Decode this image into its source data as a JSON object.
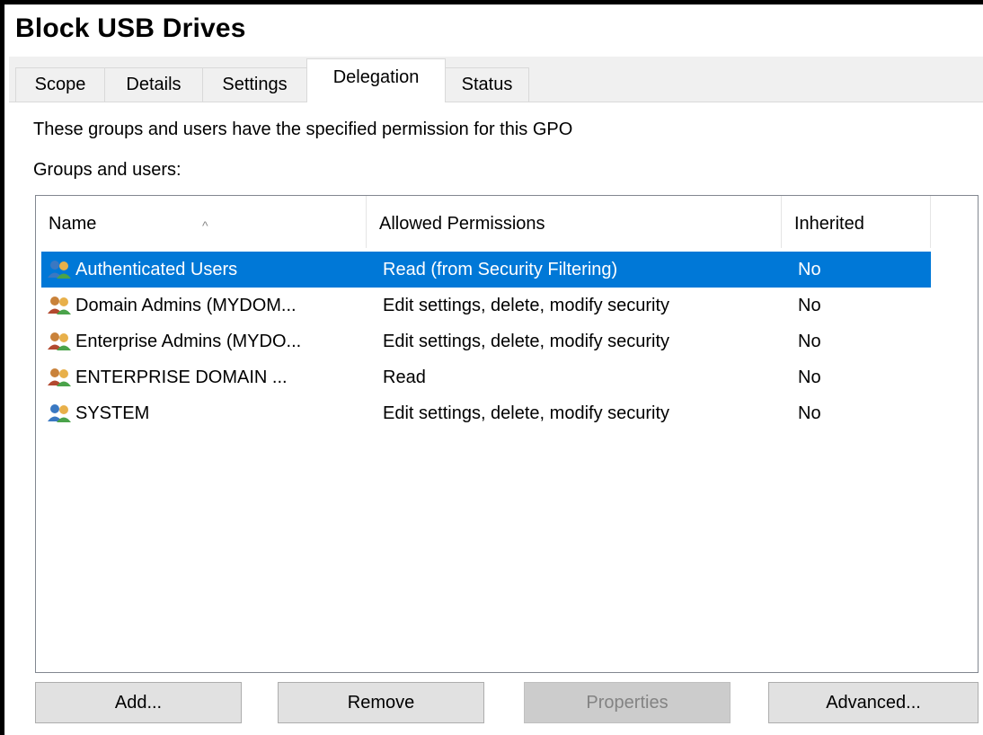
{
  "window": {
    "title": "Block USB Drives"
  },
  "tabs": [
    {
      "label": "Scope"
    },
    {
      "label": "Details"
    },
    {
      "label": "Settings"
    },
    {
      "label": "Delegation",
      "active": true
    },
    {
      "label": "Status"
    }
  ],
  "delegation": {
    "description": "These groups and users have the specified permission for this GPO",
    "groups_label": "Groups and users:",
    "columns": {
      "name": "Name",
      "permissions": "Allowed Permissions",
      "inherited": "Inherited"
    },
    "sort_indicator": "^",
    "rows": [
      {
        "name": "Authenticated Users",
        "permissions": "Read (from Security Filtering)",
        "inherited": "No",
        "selected": true,
        "icon": "users-group-icon"
      },
      {
        "name": "Domain Admins (MYDOM...",
        "permissions": "Edit settings, delete, modify security",
        "inherited": "No",
        "icon": "users-group-icon"
      },
      {
        "name": "Enterprise Admins (MYDO...",
        "permissions": "Edit settings, delete, modify security",
        "inherited": "No",
        "icon": "users-group-icon"
      },
      {
        "name": "ENTERPRISE DOMAIN ...",
        "permissions": "Read",
        "inherited": "No",
        "icon": "users-group-icon"
      },
      {
        "name": "SYSTEM",
        "permissions": "Edit settings, delete, modify security",
        "inherited": "No",
        "icon": "users-group-icon"
      }
    ]
  },
  "buttons": {
    "add": "Add...",
    "remove": "Remove",
    "properties": "Properties",
    "advanced": "Advanced..."
  },
  "colors": {
    "selection": "#0078d7",
    "tab_bg": "#f0f0f0",
    "button_bg": "#e1e1e1",
    "disabled_button_bg": "#cccccc"
  }
}
